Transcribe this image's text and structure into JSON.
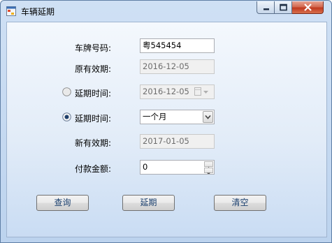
{
  "window": {
    "title": "车辆延期",
    "icon": "app-form-icon",
    "controls": [
      "minimize-icon",
      "maximize-icon",
      "close-icon"
    ],
    "close_color": "#c7412b"
  },
  "form": {
    "plate_label": "车牌号码:",
    "plate_value": "粤545454",
    "orig_expiry_label": "原有效期:",
    "orig_expiry_value": "2016-12-05",
    "extend_date_label": "延期时间:",
    "extend_date_value": "2016-12-05",
    "extend_date_selected": false,
    "extend_period_label": "延期时间:",
    "extend_period_value": "一个月",
    "extend_period_selected": true,
    "new_expiry_label": "新有效期:",
    "new_expiry_value": "2017-01-05",
    "amount_label": "付款金额:",
    "amount_value": "0"
  },
  "buttons": {
    "query": "查询",
    "extend": "延期",
    "clear": "清空"
  }
}
